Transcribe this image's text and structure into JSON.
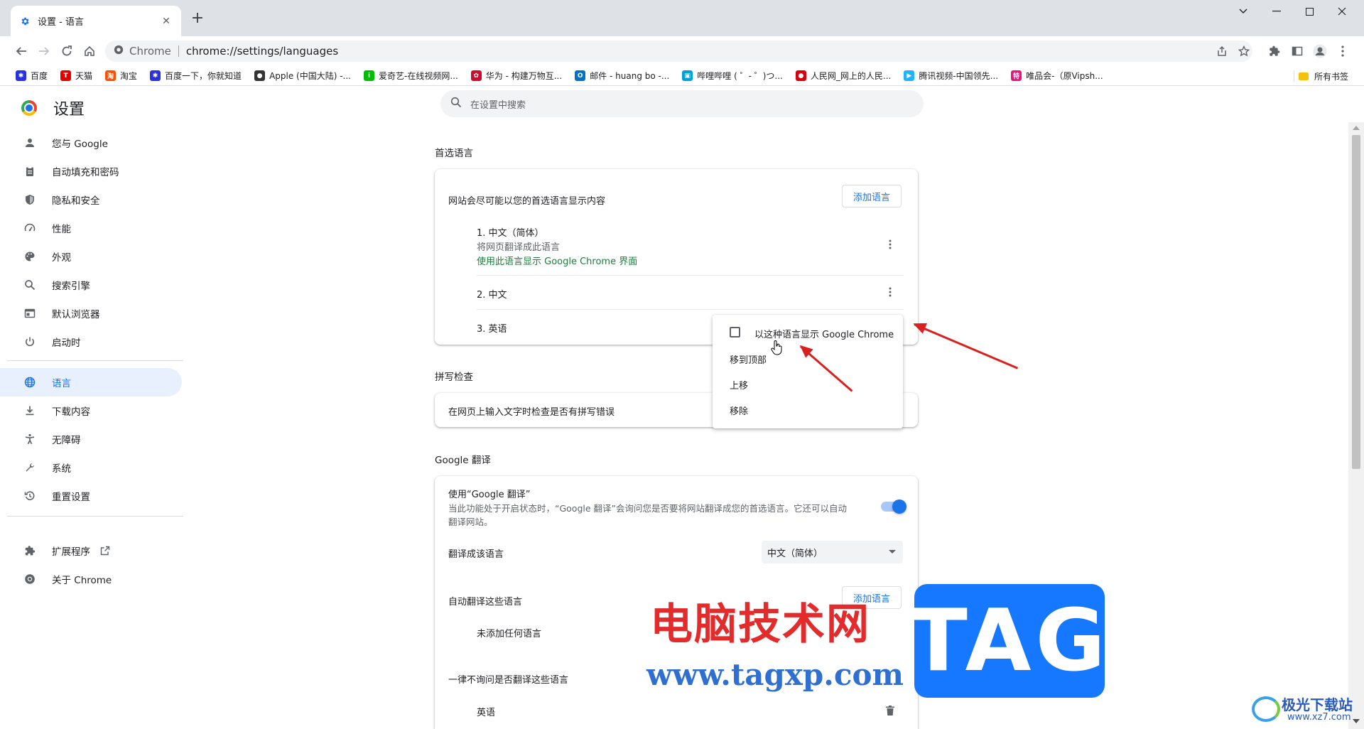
{
  "browser": {
    "tab_title": "设置 - 语言",
    "omnibox_site": "Chrome",
    "url": "chrome://settings/languages",
    "bookmarks": [
      {
        "label": "百度",
        "color": "#2932e1",
        "glyph": "✱"
      },
      {
        "label": "天猫",
        "color": "#e50000",
        "glyph": "T"
      },
      {
        "label": "淘宝",
        "color": "#ff5000",
        "glyph": "淘"
      },
      {
        "label": "百度一下，你就知道",
        "color": "#2932e1",
        "glyph": "✱"
      },
      {
        "label": "Apple (中国大陆) -...",
        "color": "#333333",
        "glyph": "●"
      },
      {
        "label": "爱奇艺-在线视频网...",
        "color": "#00be06",
        "glyph": "i"
      },
      {
        "label": "华为 - 构建万物互...",
        "color": "#cf0a2c",
        "glyph": "✿"
      },
      {
        "label": "邮件 - huang bo -...",
        "color": "#0072c6",
        "glyph": "O"
      },
      {
        "label": "哔哩哔哩 ( ゜- ゜)つ...",
        "color": "#00a1d6",
        "glyph": "▣"
      },
      {
        "label": "人民网_网上的人民...",
        "color": "#d7000f",
        "glyph": "●"
      },
      {
        "label": "腾讯视频-中国领先...",
        "color": "#20b3ff",
        "glyph": "▶"
      },
      {
        "label": "唯品会-（原Vipsh...",
        "color": "#e8157e",
        "glyph": "特"
      }
    ],
    "all_bookmarks": "所有书签"
  },
  "settings": {
    "title": "设置",
    "search_placeholder": "在设置中搜索",
    "nav": [
      {
        "label": "您与 Google",
        "icon": "person-icon"
      },
      {
        "label": "自动填充和密码",
        "icon": "clipboard-icon"
      },
      {
        "label": "隐私和安全",
        "icon": "shield-icon"
      },
      {
        "label": "性能",
        "icon": "speedometer-icon"
      },
      {
        "label": "外观",
        "icon": "palette-icon"
      },
      {
        "label": "搜索引擎",
        "icon": "search-icon"
      },
      {
        "label": "默认浏览器",
        "icon": "browser-icon"
      },
      {
        "label": "启动时",
        "icon": "power-icon"
      },
      {
        "label": "语言",
        "icon": "globe-icon"
      },
      {
        "label": "下载内容",
        "icon": "download-icon"
      },
      {
        "label": "无障碍",
        "icon": "accessibility-icon"
      },
      {
        "label": "系统",
        "icon": "wrench-icon"
      },
      {
        "label": "重置设置",
        "icon": "history-icon"
      }
    ],
    "extensions": "扩展程序",
    "about": "关于 Chrome"
  },
  "preferred": {
    "section_title": "首选语言",
    "desc": "网站会尽可能以您的首选语言显示内容",
    "add_button": "添加语言",
    "languages": [
      {
        "name": "1. 中文（简体）",
        "sub": "将网页翻译成此语言",
        "note": "使用此语言显示 Google Chrome 界面"
      },
      {
        "name": "2. 中文"
      },
      {
        "name": "3. 英语"
      }
    ]
  },
  "context_menu": {
    "display_chrome": "以这种语言显示 Google Chrome",
    "move_top": "移到顶部",
    "move_up": "上移",
    "remove": "移除"
  },
  "spell": {
    "section_title": "拼写检查",
    "desc": "在网页上输入文字时检查是否有拼写错误"
  },
  "translate": {
    "section_title": "Google 翻译",
    "use_title": "使用“Google 翻译”",
    "use_desc_1": "当此功能处于开启状态时，“Google 翻译”会询问您是否要将网站翻译成您的首选语言。它还可以自动",
    "use_desc_2": "翻译网站。",
    "enabled": true,
    "target_label": "翻译成该语言",
    "target_value": "中文（简体）",
    "auto_label": "自动翻译这些语言",
    "auto_add_button": "添加语言",
    "auto_empty": "未添加任何语言",
    "never_label": "一律不询问是否翻译这些语言",
    "never_item": "英语"
  },
  "watermark": {
    "site_name": "电脑技术网",
    "site_url": "www.tagxp.com",
    "badge": "TAG",
    "xz_name": "极光下载站",
    "xz_url": "www.xz7.com"
  },
  "colors": {
    "accent": "#1a73e8",
    "green": "#188038",
    "annotation_red": "#d9201f"
  }
}
